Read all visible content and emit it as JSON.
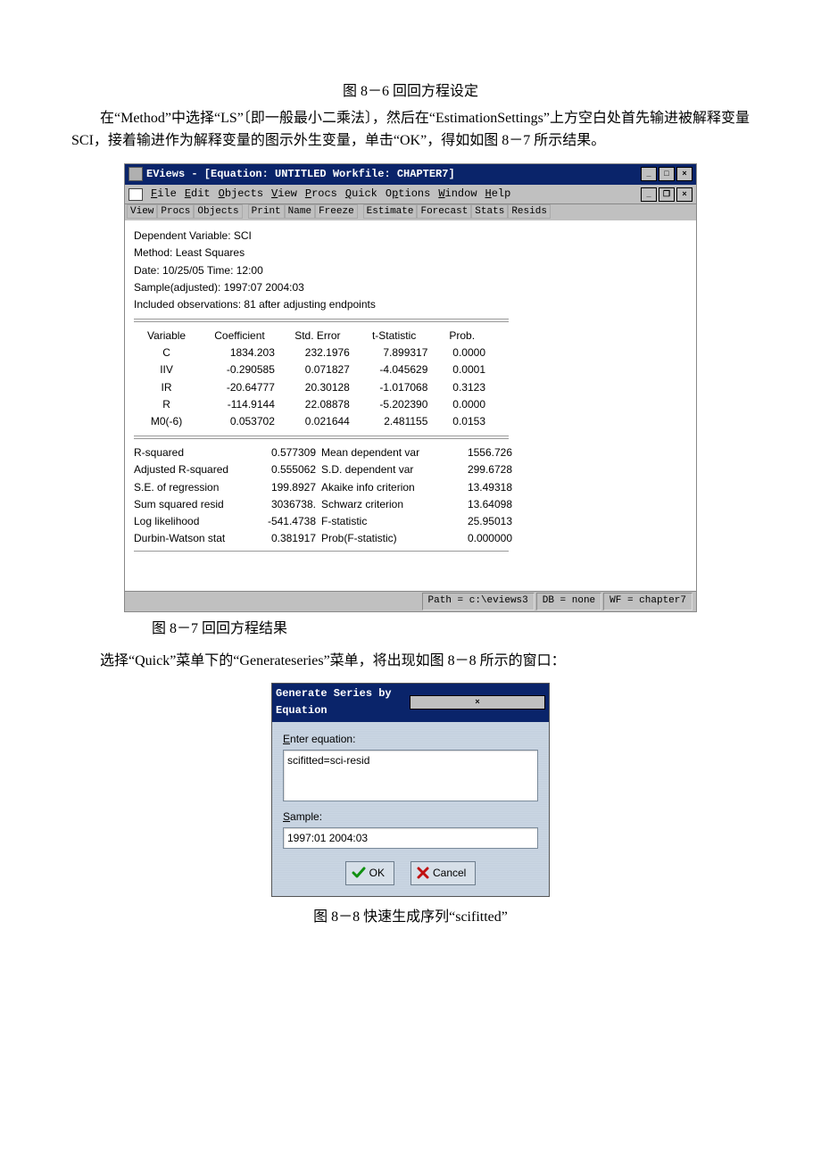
{
  "captions": {
    "top": "图 8－6 回回方程设定",
    "midLeft": "图 8－7 回回方程结果",
    "bottom": "图 8－8 快速生成序列“scifitted”"
  },
  "paragraphs": {
    "p1": "在“Method”中选择“LS”〔即一般最小二乘法〕，然后在“EstimationSettings”上方空白处首先输进被解释变量 SCI，接着输进作为解释变量的图示外生变量，单击“OK”，得如如图 8－7 所示结果。",
    "p2": "选择“Quick”菜单下的“Generateseries”菜单，将出现如图 8－8 所示的窗口："
  },
  "eviews": {
    "title": "EViews - [Equation: UNTITLED   Workfile: CHAPTER7]",
    "menus": {
      "file": "File",
      "edit": "Edit",
      "objects": "Objects",
      "view": "View",
      "procs": "Procs",
      "quick": "Quick",
      "options": "Options",
      "window": "Window",
      "help": "Help"
    },
    "toolbar": [
      "View",
      "Procs",
      "Objects",
      "Print",
      "Name",
      "Freeze",
      "Estimate",
      "Forecast",
      "Stats",
      "Resids"
    ],
    "header": {
      "l1": "Dependent Variable: SCI",
      "l2": "Method: Least Squares",
      "l3": "Date: 10/25/05   Time: 12:00",
      "l4": "Sample(adjusted): 1997:07 2004:03",
      "l5": "Included observations: 81 after adjusting endpoints"
    },
    "cols": {
      "c1": "Variable",
      "c2": "Coefficient",
      "c3": "Std. Error",
      "c4": "t-Statistic",
      "c5": "Prob."
    },
    "rows": [
      {
        "v": "C",
        "co": "1834.203",
        "se": "232.1976",
        "t": "7.899317",
        "p": "0.0000"
      },
      {
        "v": "IIV",
        "co": "-0.290585",
        "se": "0.071827",
        "t": "-4.045629",
        "p": "0.0001"
      },
      {
        "v": "IR",
        "co": "-20.64777",
        "se": "20.30128",
        "t": "-1.017068",
        "p": "0.3123"
      },
      {
        "v": "R",
        "co": "-114.9144",
        "se": "22.08878",
        "t": "-5.202390",
        "p": "0.0000"
      },
      {
        "v": "M0(-6)",
        "co": "0.053702",
        "se": "0.021644",
        "t": "2.481155",
        "p": "0.0153"
      }
    ],
    "stats": [
      {
        "a": "R-squared",
        "av": "0.577309",
        "b": "Mean dependent var",
        "bv": "1556.726"
      },
      {
        "a": "Adjusted R-squared",
        "av": "0.555062",
        "b": "S.D. dependent var",
        "bv": "299.6728"
      },
      {
        "a": "S.E. of regression",
        "av": "199.8927",
        "b": "Akaike info criterion",
        "bv": "13.49318"
      },
      {
        "a": "Sum squared resid",
        "av": "3036738.",
        "b": "Schwarz criterion",
        "bv": "13.64098"
      },
      {
        "a": "Log likelihood",
        "av": "-541.4738",
        "b": "F-statistic",
        "bv": "25.95013"
      },
      {
        "a": "Durbin-Watson stat",
        "av": "0.381917",
        "b": "Prob(F-statistic)",
        "bv": "0.000000"
      }
    ],
    "status": {
      "path": "Path = c:\\eviews3",
      "db": "DB = none",
      "wf": "WF = chapter7"
    }
  },
  "dialog": {
    "title": "Generate Series by Equation",
    "eqLabel": "Enter equation:",
    "eqValue": "scifitted=sci-resid",
    "sampleLabel": "Sample:",
    "sampleValue": "1997:01 2004:03",
    "ok": "OK",
    "cancel": "Cancel"
  }
}
